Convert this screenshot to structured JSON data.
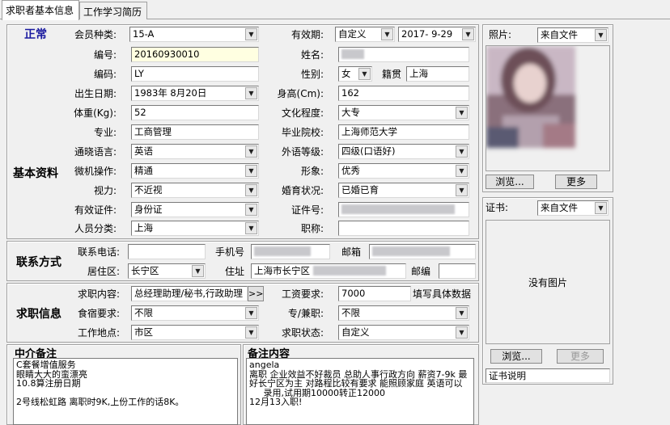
{
  "tabs": [
    "求职者基本信息",
    "工作学习简历"
  ],
  "member": {
    "badge": "正常",
    "member_type_label": "会员种类:",
    "member_type": "15-A",
    "valid_label": "有效期:",
    "valid_mode": "自定义",
    "valid_date": "2017- 9-29"
  },
  "basic": {
    "section": "基本资料",
    "number_label": "编号:",
    "number": "20160930010",
    "name_label": "姓名:",
    "code_label": "编码:",
    "code": "LY",
    "gender_label": "性别:",
    "gender": "女",
    "native_label": "籍贯",
    "native": "上海",
    "birth_label": "出生日期:",
    "birth": "1983年 8月20日",
    "height_label": "身高(Cm):",
    "height": "162",
    "weight_label": "体重(Kg):",
    "weight": "52",
    "edu_label": "文化程度:",
    "edu": "大专",
    "major_label": "专业:",
    "major": "工商管理",
    "school_label": "毕业院校:",
    "school": "上海师范大学",
    "lang_label": "通晓语言:",
    "lang": "英语",
    "flang_label": "外语等级:",
    "flang": "四级(口语好)",
    "pc_label": "微机操作:",
    "pc": "精通",
    "image_label": "形象:",
    "image": "优秀",
    "vision_label": "视力:",
    "vision": "不近视",
    "marriage_label": "婚育状况:",
    "marriage": "已婚已育",
    "id_type_label": "有效证件:",
    "id_type": "身份证",
    "id_no_label": "证件号:",
    "category_label": "人员分类:",
    "category": "上海",
    "title_label": "职称:",
    "title": ""
  },
  "contact": {
    "section": "联系方式",
    "phone_label": "联系电话:",
    "mobile_label": "手机号",
    "email_label": "邮箱",
    "district_label": "居住区:",
    "district": "长宁区",
    "address_label": "住址",
    "address": "上海市长宁区",
    "zip_label": "邮编"
  },
  "job": {
    "section": "求职信息",
    "content_label": "求职内容:",
    "content": "总经理助理/秘书,行政助理",
    "more_btn": ">>",
    "salary_label": "工资要求:",
    "salary": "7000",
    "salary_hint": "填写具体数据",
    "meal_label": "食宿要求:",
    "meal": "不限",
    "parttime_label": "专/兼职:",
    "parttime": "不限",
    "place_label": "工作地点:",
    "place": "市区",
    "status_label": "求职状态:",
    "status": "自定义"
  },
  "photo": {
    "label": "照片:",
    "source": "来自文件",
    "browse": "浏览...",
    "more": "更多"
  },
  "cert": {
    "label": "证书:",
    "source": "来自文件",
    "no_image": "没有图片",
    "browse": "浏览...",
    "more": "更多",
    "desc": "证书说明"
  },
  "agency_note": {
    "title": "中介备注",
    "text": "C套餐增值服务\n眼睛大大的蛮漂亮\n10.8算注册日期\n\n2号线松虹路 离职时9K,上份工作的话8K。"
  },
  "remark": {
    "title": "备注内容",
    "text": "angela\n离职 企业效益不好裁员 总助人事行政方向 薪资7-9k 最好长宁区为主 对路程比较有要求 能照顾家庭 英语可以\n     录用,试用期10000转正12000\n12月13入职!"
  }
}
